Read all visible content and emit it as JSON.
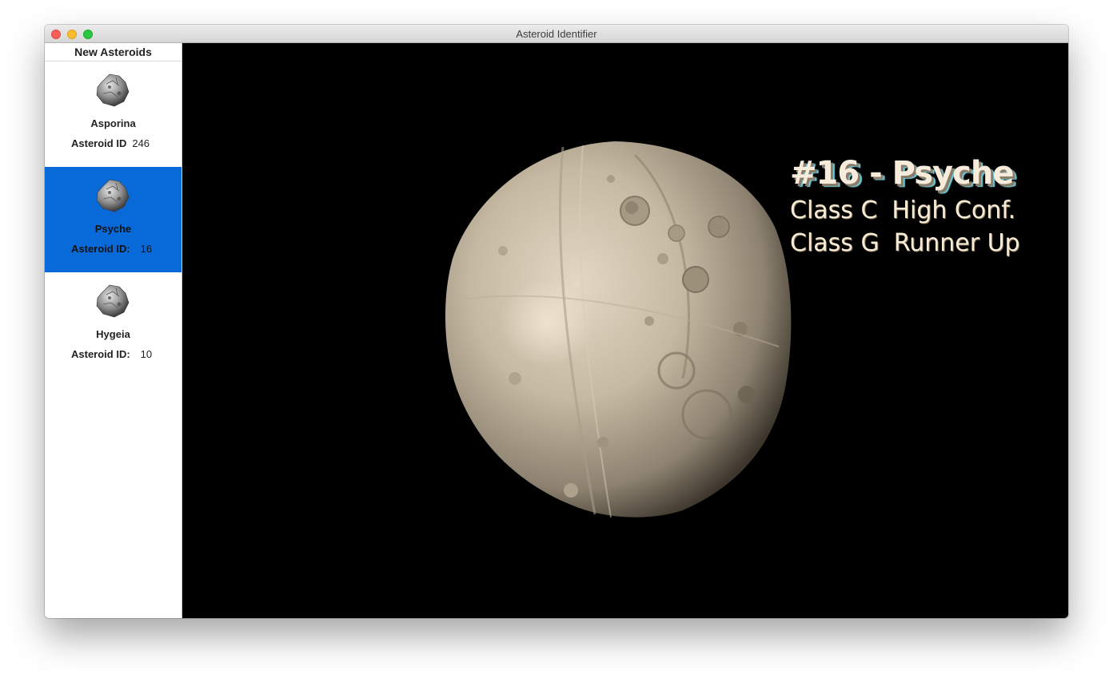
{
  "window": {
    "title": "Asteroid Identifier"
  },
  "sidebar": {
    "header": "New Asteroids",
    "items": [
      {
        "name": "Asporina",
        "id_label": "Asteroid ID",
        "id_value": "246",
        "selected": false,
        "icon": "asteroid-icon"
      },
      {
        "name": "Psyche",
        "id_label": "Asteroid ID:",
        "id_value": "16",
        "selected": true,
        "icon": "asteroid-icon"
      },
      {
        "name": "Hygeia",
        "id_label": "Asteroid ID:",
        "id_value": "10",
        "selected": false,
        "icon": "asteroid-icon"
      }
    ]
  },
  "viewer": {
    "heading": "#16 - Psyche",
    "lines": [
      {
        "cls": "Class C",
        "confidence": "High Conf."
      },
      {
        "cls": "Class G",
        "confidence": "Runner Up"
      }
    ]
  },
  "colors": {
    "selection": "#0869d9",
    "viewport_background": "#000000",
    "asteroid_surface": "#c8bca6",
    "label_text": "#f6ead8"
  }
}
